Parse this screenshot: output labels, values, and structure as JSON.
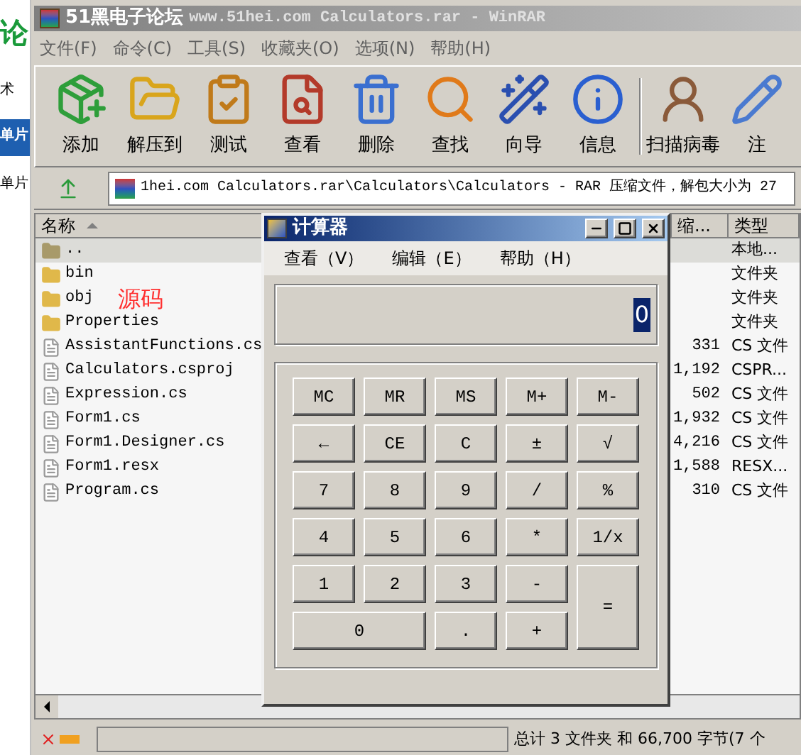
{
  "background_page": [
    {
      "text": "论",
      "kind": "logo"
    },
    {
      "text": "术",
      "kind": "plain"
    },
    {
      "text": "单片",
      "kind": "banner"
    },
    {
      "text": "单片",
      "kind": "plain"
    }
  ],
  "window": {
    "app_name": "51黑电子论坛",
    "title": "www.51hei.com Calculators.rar - WinRAR"
  },
  "menu": [
    "文件(F)",
    "命令(C)",
    "工具(S)",
    "收藏夹(O)",
    "选项(N)",
    "帮助(H)"
  ],
  "toolbar": [
    {
      "label": "添加",
      "kind": "add"
    },
    {
      "label": "解压到",
      "kind": "extract"
    },
    {
      "label": "测试",
      "kind": "test"
    },
    {
      "label": "查看",
      "kind": "view"
    },
    {
      "label": "删除",
      "kind": "delete"
    },
    {
      "label": "查找",
      "kind": "find"
    },
    {
      "label": "向导",
      "kind": "wizard"
    },
    {
      "label": "信息",
      "kind": "info"
    },
    {
      "label": "扫描病毒",
      "kind": "virus"
    },
    {
      "label": "注",
      "kind": "comment"
    }
  ],
  "address": "1hei.com Calculators.rar\\Calculators\\Calculators - RAR 压缩文件，解包大小为 27",
  "columns": [
    "名称",
    "缩...",
    "类型"
  ],
  "rows": [
    {
      "name": "..",
      "kind": "up",
      "type": "本地...",
      "selected": true
    },
    {
      "name": "bin",
      "kind": "folder",
      "type": "文件夹",
      "selected": false
    },
    {
      "name": "obj",
      "kind": "folder",
      "type": "文件夹",
      "selected": false
    },
    {
      "name": "Properties",
      "kind": "folder",
      "type": "文件夹",
      "selected": false
    },
    {
      "name": "AssistantFunctions.cs",
      "kind": "file",
      "size": "331",
      "type": "CS 文件",
      "selected": false
    },
    {
      "name": "Calculators.csproj",
      "kind": "file",
      "size": "1,192",
      "type": "CSPR...",
      "selected": false
    },
    {
      "name": "Expression.cs",
      "kind": "file",
      "size": "502",
      "type": "CS 文件",
      "selected": false
    },
    {
      "name": "Form1.cs",
      "kind": "file",
      "size": "1,932",
      "type": "CS 文件",
      "selected": false
    },
    {
      "name": "Form1.Designer.cs",
      "kind": "file",
      "size": "4,216",
      "type": "CS 文件",
      "selected": false
    },
    {
      "name": "Form1.resx",
      "kind": "file",
      "size": "1,588",
      "type": "RESX...",
      "selected": false
    },
    {
      "name": "Program.cs",
      "kind": "file",
      "size": "310",
      "type": "CS 文件",
      "selected": false
    }
  ],
  "annotation": "源码",
  "status_bar": "总计 3 文件夹 和 66,700 字节(7 个",
  "calculator": {
    "title": "计算器",
    "menu": [
      "查看（V）",
      "编辑（E）",
      "帮助（H）"
    ],
    "display": "0",
    "buttons": [
      {
        "label": "MC",
        "kind": "normal"
      },
      {
        "label": "MR",
        "kind": "normal"
      },
      {
        "label": "MS",
        "kind": "normal"
      },
      {
        "label": "M+",
        "kind": "normal"
      },
      {
        "label": "M-",
        "kind": "normal"
      },
      {
        "label": "←",
        "kind": "normal"
      },
      {
        "label": "CE",
        "kind": "normal"
      },
      {
        "label": "C",
        "kind": "normal"
      },
      {
        "label": "±",
        "kind": "normal"
      },
      {
        "label": "√",
        "kind": "normal"
      },
      {
        "label": "7",
        "kind": "normal"
      },
      {
        "label": "8",
        "kind": "normal"
      },
      {
        "label": "9",
        "kind": "normal"
      },
      {
        "label": "/",
        "kind": "normal"
      },
      {
        "label": "%",
        "kind": "normal"
      },
      {
        "label": "4",
        "kind": "normal"
      },
      {
        "label": "5",
        "kind": "normal"
      },
      {
        "label": "6",
        "kind": "normal"
      },
      {
        "label": "*",
        "kind": "normal"
      },
      {
        "label": "1/x",
        "kind": "normal"
      },
      {
        "label": "1",
        "kind": "normal"
      },
      {
        "label": "2",
        "kind": "normal"
      },
      {
        "label": "3",
        "kind": "normal"
      },
      {
        "label": "-",
        "kind": "normal"
      },
      {
        "label": "=",
        "kind": "tall"
      },
      {
        "label": "0",
        "kind": "wide"
      },
      {
        "label": ".",
        "kind": "normal"
      },
      {
        "label": "+",
        "kind": "normal"
      }
    ]
  }
}
